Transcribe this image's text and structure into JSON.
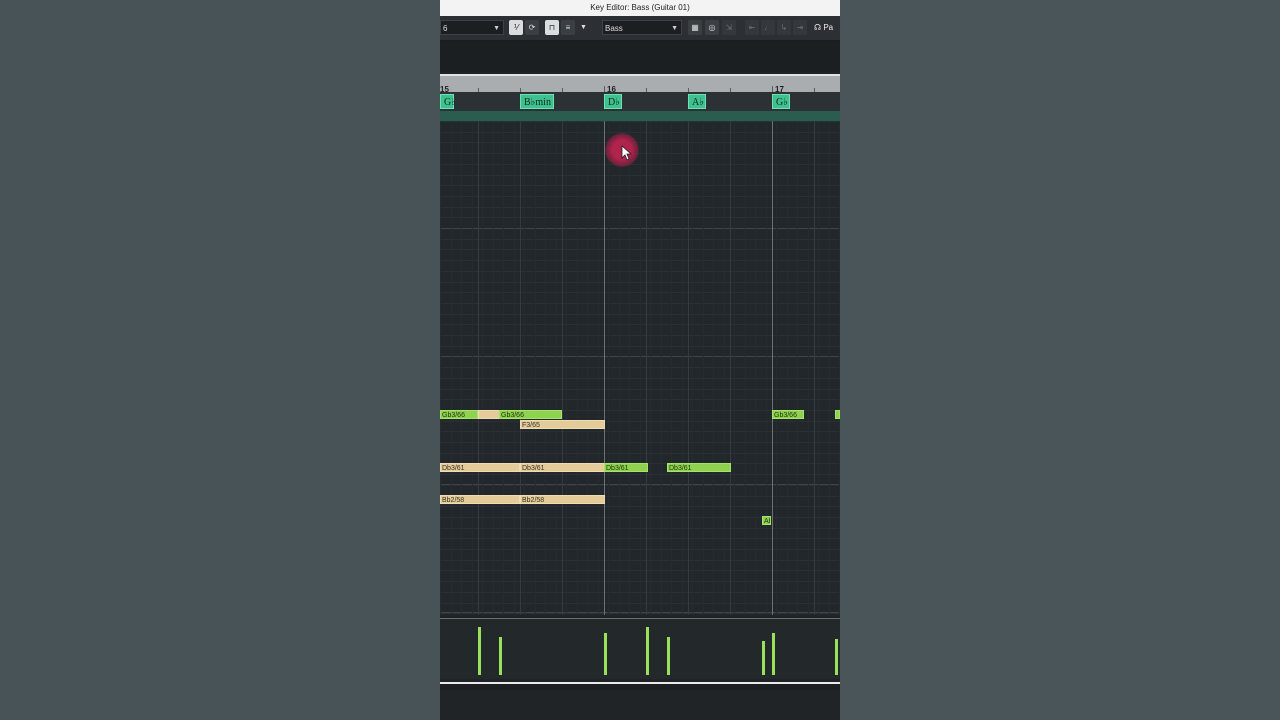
{
  "window": {
    "title": "Key Editor: Bass (Guitar 01)"
  },
  "toolbar": {
    "quantize_value": "6",
    "track_select": "Bass",
    "panel_label": "Pa",
    "icons": [
      "quantize-icon",
      "loop-icon",
      "snap-icon",
      "list-icon",
      "dropdown-icon",
      "grid-icon",
      "tempo-icon",
      "audio-icon",
      "step-record-icon",
      "note-icon",
      "arrow-icon",
      "ladder-icon",
      "chord-assist-icon"
    ]
  },
  "ruler": {
    "bars": [
      "15",
      "16",
      "17"
    ]
  },
  "chord_track": {
    "chords": [
      {
        "label": "G♭"
      },
      {
        "label": "B♭min"
      },
      {
        "label": "D♭"
      },
      {
        "label": "A♭"
      },
      {
        "label": "G♭"
      }
    ]
  },
  "notes": [
    {
      "label": "Gb3/66",
      "color": "green"
    },
    {
      "label": "",
      "color": "tan"
    },
    {
      "label": "Gb3/66",
      "color": "green"
    },
    {
      "label": "F3/65",
      "color": "tan"
    },
    {
      "label": "Db3/61",
      "color": "tan"
    },
    {
      "label": "Db3/61",
      "color": "tan"
    },
    {
      "label": "Db3/61",
      "color": "green"
    },
    {
      "label": "Db3/61",
      "color": "green"
    },
    {
      "label": "Bb2/58",
      "color": "tan"
    },
    {
      "label": "Bb2/58",
      "color": "tan"
    },
    {
      "label": "Ab",
      "color": "green"
    },
    {
      "label": "Gb3/66",
      "color": "green"
    },
    {
      "label": "",
      "color": "green"
    }
  ],
  "colors": {
    "note_green": "#8fd24f",
    "note_tan": "#e3cc9a",
    "chord": "#3fc08f",
    "cursor": "#b0234d"
  }
}
